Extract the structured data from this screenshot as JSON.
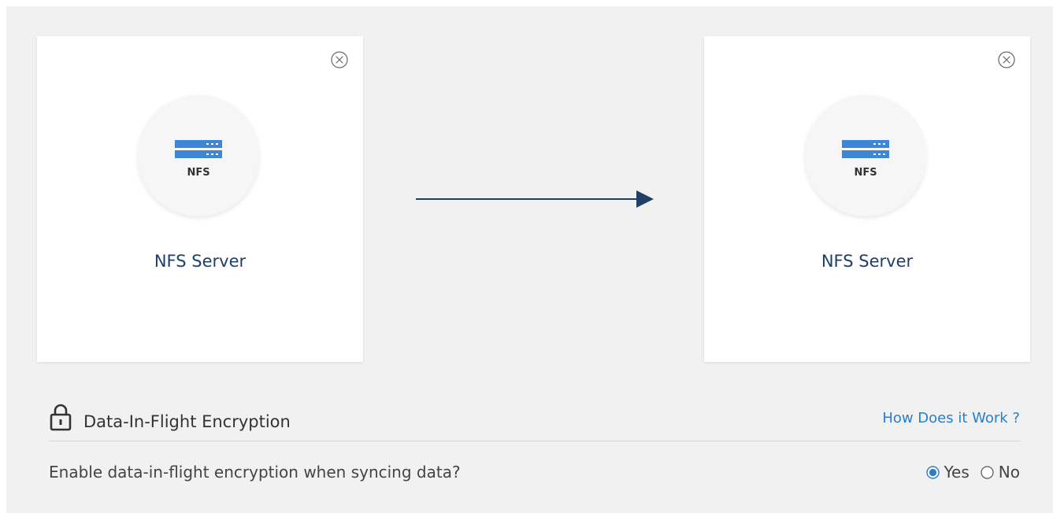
{
  "source_card": {
    "icon": "nfs-server-icon",
    "icon_caption": "NFS",
    "title": "NFS Server",
    "close_icon": "close-circle-icon"
  },
  "target_card": {
    "icon": "nfs-server-icon",
    "icon_caption": "NFS",
    "title": "NFS Server",
    "close_icon": "close-circle-icon"
  },
  "flow": {
    "icon": "arrow-right-icon"
  },
  "encryption": {
    "icon": "lock-icon",
    "title": "Data-In-Flight Encryption",
    "help_link": "How Does it Work ?",
    "question": "Enable data-in-flight encryption when syncing data?",
    "options": [
      {
        "label": "Yes",
        "selected": true
      },
      {
        "label": "No",
        "selected": false
      }
    ]
  },
  "colors": {
    "panel_bg": "#f2f2f2",
    "card_bg": "#ffffff",
    "title_text": "#1f3f66",
    "server_icon_blue": "#3d86d6",
    "link": "#2b7dc7",
    "arrow": "#1f3f66",
    "radio_selected": "#2b7dc7"
  }
}
